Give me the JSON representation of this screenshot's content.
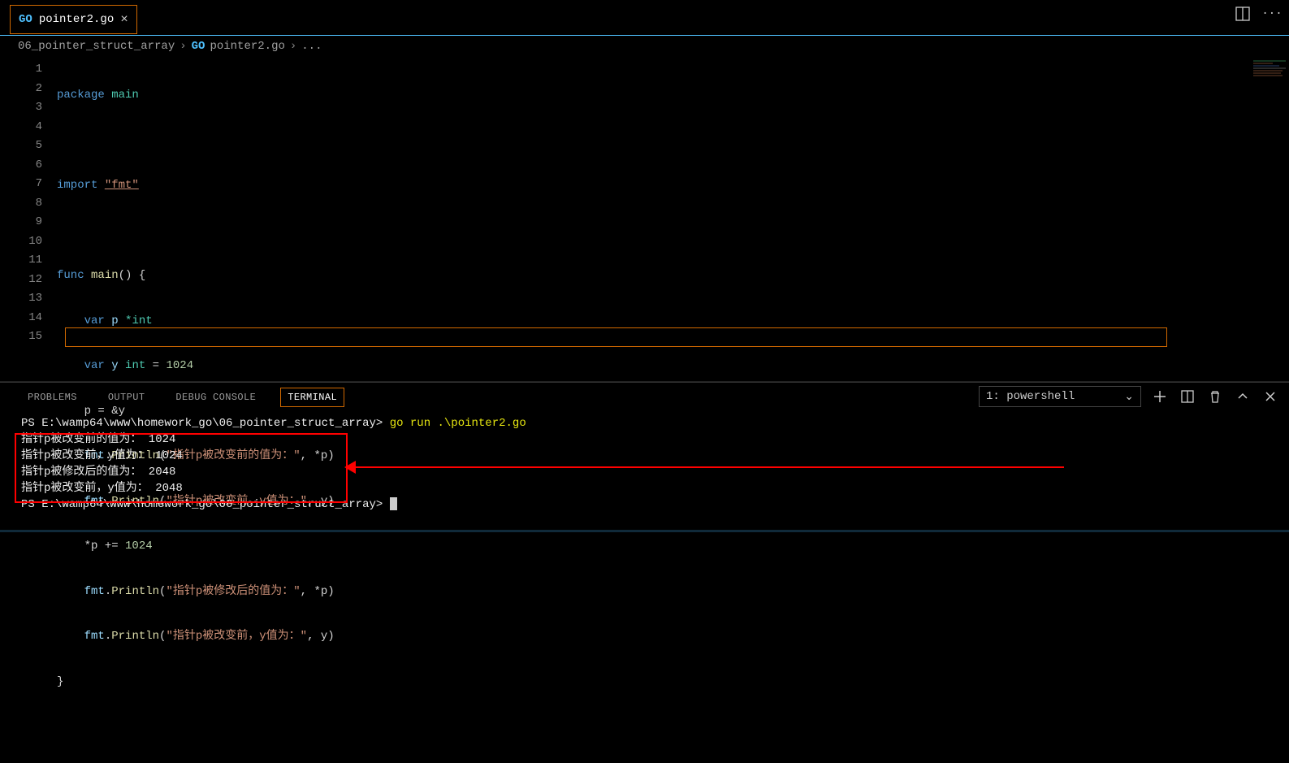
{
  "tab": {
    "filename": "pointer2.go"
  },
  "breadcrumb": {
    "folder": "06_pointer_struct_array",
    "file": "pointer2.go",
    "trail": "..."
  },
  "code": {
    "l1": {
      "kw": "package",
      "ident": "main"
    },
    "l3": {
      "kw": "import",
      "str": "\"fmt\""
    },
    "l5": {
      "kw": "func",
      "fn": "main",
      "rest": "() {"
    },
    "l6": {
      "kw": "var",
      "ident": "p",
      "type": "*int"
    },
    "l7": {
      "kw": "var",
      "ident": "y",
      "type": "int",
      "eq": " = ",
      "num": "1024"
    },
    "l8": {
      "text": "p = &y"
    },
    "l9": {
      "obj": "fmt",
      "fn": "Println",
      "str": "\"指针p被改变前的值为：\"",
      "arg": ", *p)"
    },
    "l10": {
      "obj": "fmt",
      "fn": "Println",
      "str": "\"指针p被改变前，y值为：\"",
      "arg": ", y)"
    },
    "l11": {
      "text": "*p += ",
      "num": "1024"
    },
    "l12": {
      "obj": "fmt",
      "fn": "Println",
      "str": "\"指针p被修改后的值为：\"",
      "arg": ", *p)"
    },
    "l13": {
      "obj": "fmt",
      "fn": "Println",
      "str": "\"指针p被改变前，y值为：\"",
      "arg": ", y)"
    },
    "l14": {
      "text": "}"
    }
  },
  "panel": {
    "tabs": {
      "problems": "PROBLEMS",
      "output": "OUTPUT",
      "debug": "DEBUG CONSOLE",
      "terminal": "TERMINAL"
    },
    "selector": "1: powershell"
  },
  "terminal": {
    "promptPath": "PS E:\\wamp64\\www\\homework_go\\06_pointer_struct_array>",
    "cmd": "go run .\\pointer2.go",
    "out1": "指针p被改变前的值为： 1024",
    "out2": "指针p被改变前，y值为： 1024",
    "out3": "指针p被修改后的值为： 2048",
    "out4": "指针p被改变前，y值为： 2048"
  }
}
